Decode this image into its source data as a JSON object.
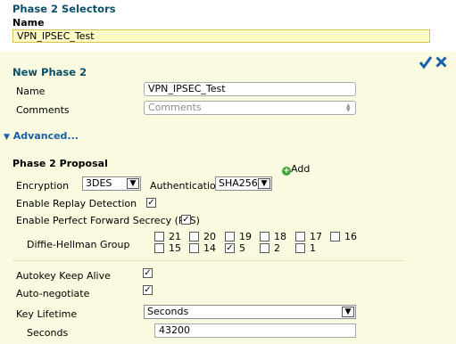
{
  "selectors": {
    "heading": "Phase 2 Selectors",
    "name_label": "Name",
    "name_value": "VPN_IPSEC_Test"
  },
  "new_phase2": {
    "heading": "New Phase 2",
    "name_label": "Name",
    "name_value": "VPN_IPSEC_Test",
    "comments_label": "Comments",
    "comments_placeholder": "Comments",
    "advanced_label": "Advanced..."
  },
  "proposal": {
    "heading": "Phase 2 Proposal",
    "add_label": "Add",
    "encryption_label": "Encryption",
    "encryption_value": "3DES",
    "authentication_label": "Authentication",
    "authentication_value": "SHA256",
    "replay_label": "Enable Replay Detection",
    "replay_checked": true,
    "pfs_label": "Enable Perfect Forward Secrecy (PFS)",
    "pfs_checked": true,
    "dh_label": "Diffie-Hellman Group",
    "dh_groups_row1": [
      "21",
      "20",
      "19",
      "18",
      "17",
      "16"
    ],
    "dh_groups_row2": [
      "15",
      "14",
      "5",
      "2",
      "1"
    ],
    "dh_selected": "5"
  },
  "options": {
    "autokey_label": "Autokey Keep Alive",
    "autokey_checked": true,
    "autonegotiate_label": "Auto-negotiate",
    "autonegotiate_checked": true,
    "key_lifetime_label": "Key Lifetime",
    "key_lifetime_value": "Seconds",
    "seconds_label": "Seconds",
    "seconds_value": "43200"
  },
  "icons": {
    "confirm": "check-icon",
    "cancel": "close-icon",
    "add": "plus-circle-icon",
    "expand": "triangle-down-icon"
  },
  "colors": {
    "heading": "#0b4f68",
    "panel_bg": "#fafae0",
    "selector_bg": "#fffbc6",
    "accent": "#1a5fa8",
    "add_icon": "#3fa535"
  }
}
